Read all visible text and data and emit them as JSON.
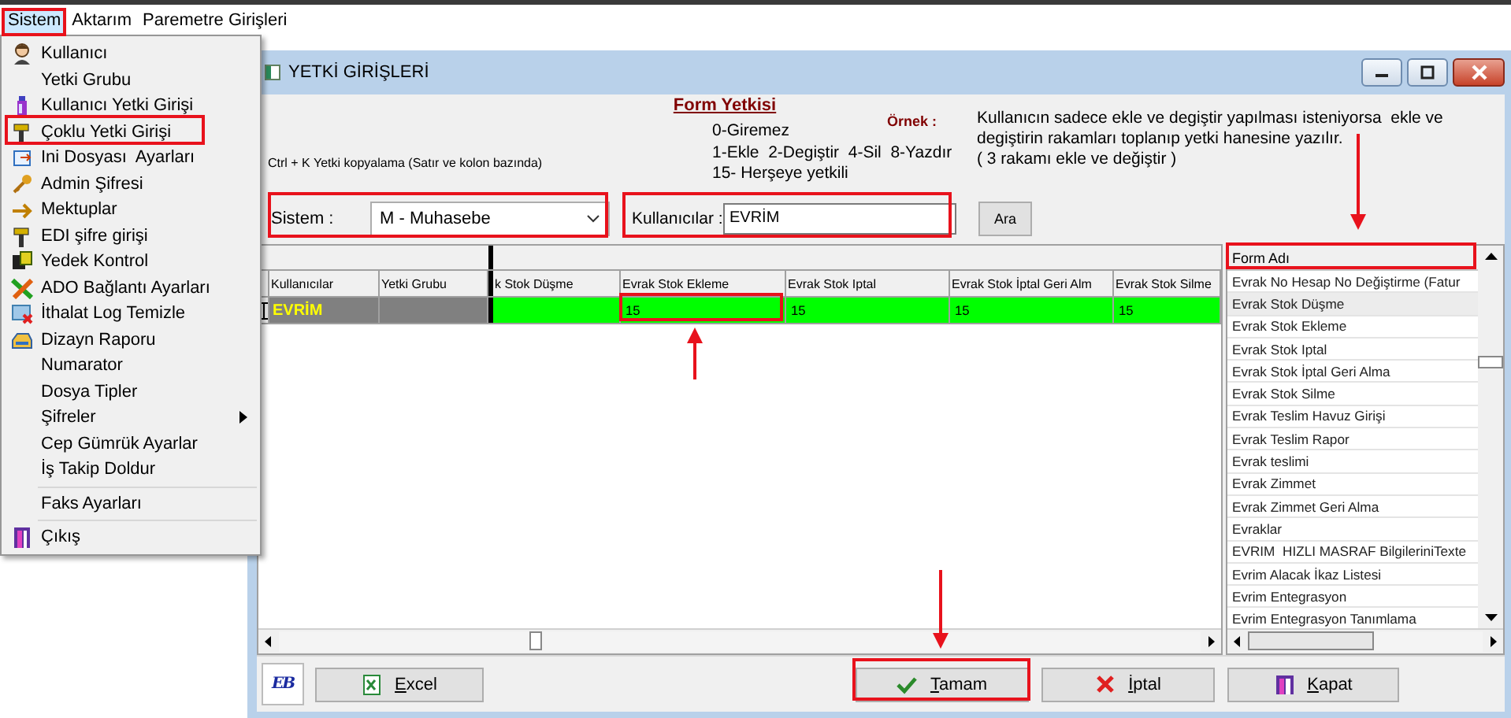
{
  "menu_bar": {
    "items": [
      {
        "label": "Sistem",
        "open": true
      },
      {
        "label": "Aktarım",
        "open": false
      },
      {
        "label": "Paremetre Girişleri",
        "open": false
      }
    ]
  },
  "sistem_menu": {
    "items": [
      {
        "kind": "item",
        "label": "Kullanıcı"
      },
      {
        "kind": "item",
        "label": "Yetki Grubu"
      },
      {
        "kind": "item",
        "label": "Kullanıcı Yetki Girişi"
      },
      {
        "kind": "item",
        "label": "Çoklu Yetki Girişi"
      },
      {
        "kind": "item",
        "label": "Ini Dosyası  Ayarları"
      },
      {
        "kind": "item",
        "label": "Admin Şifresi"
      },
      {
        "kind": "item",
        "label": "Mektuplar"
      },
      {
        "kind": "item",
        "label": "EDI şifre girişi"
      },
      {
        "kind": "item",
        "label": "Yedek Kontrol"
      },
      {
        "kind": "item",
        "label": "ADO Bağlantı Ayarları"
      },
      {
        "kind": "item",
        "label": "İthalat Log Temizle"
      },
      {
        "kind": "item",
        "label": "Dizayn Raporu"
      },
      {
        "kind": "item",
        "label": "Numarator"
      },
      {
        "kind": "item",
        "label": "Dosya Tipler"
      },
      {
        "kind": "submenu",
        "label": "Şifreler"
      },
      {
        "kind": "item",
        "label": "Cep Gümrük Ayarlar"
      },
      {
        "kind": "item",
        "label": "İş Takip Doldur"
      },
      {
        "kind": "separator"
      },
      {
        "kind": "item",
        "label": "Faks Ayarları"
      },
      {
        "kind": "separator"
      },
      {
        "kind": "item",
        "label": "Çıkış"
      }
    ]
  },
  "window": {
    "title": "YETKİ GİRİŞLERİ",
    "hint": "Ctrl + K Yetki kopyalama (Satır ve kolon bazında)",
    "form_yetkisi": {
      "title": "Form Yetkisi",
      "lines": [
        "0-Giremez",
        "1-Ekle  2-Degiştir  4-Sil  8-Yazdır",
        "15- Herşeye yetkili"
      ]
    },
    "example": {
      "label": "Örnek :",
      "lines": [
        "Kullanıcın sadece ekle ve degiştir yapılması isteniyorsa  ekle ve",
        "degiştirin rakamları toplanıp yetki hanesine yazılır.",
        "( 3 rakamı ekle ve değiştir )"
      ]
    },
    "sistem": {
      "label": "Sistem :",
      "value": "M - Muhasebe"
    },
    "kullanicilar": {
      "label": "Kullanıcılar :",
      "value": "EVRİM"
    },
    "search_button": "Ara",
    "grid": {
      "columns": [
        {
          "header": "Kullanıcılar",
          "kind": "fixed"
        },
        {
          "header": "Yetki Grubu",
          "kind": "fixed"
        },
        {
          "header": "k Stok Düşme",
          "kind": "value"
        },
        {
          "header": "Evrak Stok Ekleme",
          "kind": "value"
        },
        {
          "header": "Evrak Stok Iptal",
          "kind": "value"
        },
        {
          "header": "Evrak Stok İptal Geri Alm",
          "kind": "value"
        },
        {
          "header": "Evrak Stok Silme",
          "kind": "value"
        }
      ],
      "rows": [
        {
          "cells": [
            {
              "text": "EVRİM"
            },
            {},
            {},
            {
              "text": "15"
            },
            {
              "text": "15"
            },
            {
              "text": "15"
            },
            {
              "text": "15"
            }
          ]
        }
      ]
    },
    "form_list": {
      "header": "Form Adı",
      "items": [
        {
          "label": "Evrak No Hesap No Değiştirme (Fatur",
          "selected": false
        },
        {
          "label": "Evrak Stok Düşme",
          "selected": true
        },
        {
          "label": "Evrak Stok Ekleme",
          "selected": false
        },
        {
          "label": "Evrak Stok Iptal",
          "selected": false
        },
        {
          "label": "Evrak Stok İptal Geri Alma",
          "selected": false
        },
        {
          "label": "Evrak Stok Silme",
          "selected": false
        },
        {
          "label": "Evrak Teslim Havuz Girişi",
          "selected": false
        },
        {
          "label": "Evrak Teslim Rapor",
          "selected": false
        },
        {
          "label": "Evrak teslimi",
          "selected": false
        },
        {
          "label": "Evrak Zimmet",
          "selected": false
        },
        {
          "label": "Evrak Zimmet Geri Alma",
          "selected": false
        },
        {
          "label": "Evraklar",
          "selected": false
        },
        {
          "label": "EVRIM  HIZLI MASRAF BilgileriniTexte",
          "selected": false
        },
        {
          "label": "Evrim Alacak İkaz Listesi",
          "selected": false
        },
        {
          "label": "Evrim Entegrasyon",
          "selected": false
        },
        {
          "label": "Evrim Entegrasyon Tanımlama",
          "selected": false
        }
      ]
    },
    "logo": "EB",
    "buttons": [
      {
        "label": "Excel",
        "kind": "excel"
      },
      {
        "label": "Tamam",
        "kind": "ok"
      },
      {
        "label": "İptal",
        "kind": "cancel"
      },
      {
        "label": "Kapat",
        "kind": "close"
      }
    ]
  }
}
